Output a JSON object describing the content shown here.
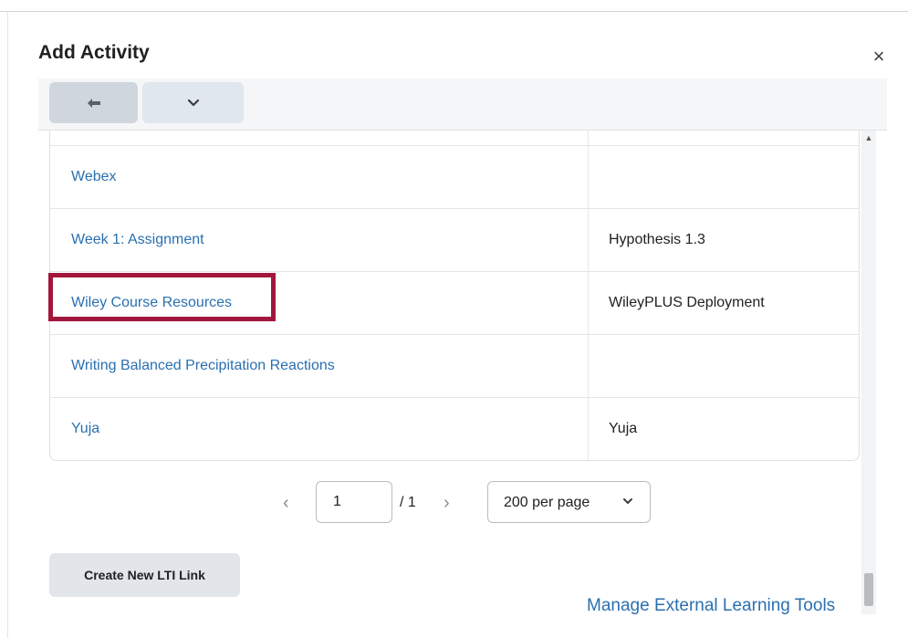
{
  "dialog": {
    "title": "Add Activity",
    "close_glyph": "×"
  },
  "toolbar": {
    "back_icon": "back-arrow-icon",
    "more_icon": "chevron-down-icon"
  },
  "activities": [
    {
      "name": "Webex",
      "tool": ""
    },
    {
      "name": "Week 1: Assignment",
      "tool": "Hypothesis 1.3"
    },
    {
      "name": "Wiley Course Resources",
      "tool": "WileyPLUS Deployment",
      "highlighted": true
    },
    {
      "name": "Writing Balanced Precipitation Reactions",
      "tool": ""
    },
    {
      "name": "Yuja",
      "tool": "Yuja"
    }
  ],
  "pagination": {
    "prev_glyph": "‹",
    "next_glyph": "›",
    "current_page": "1",
    "total_label": "/ 1",
    "per_page": "200 per page"
  },
  "actions": {
    "create_lti_label": "Create New LTI Link",
    "manage_tools_label": "Manage External Learning Tools"
  },
  "colors": {
    "link": "#2a6fb0",
    "highlight": "#a3173e"
  }
}
